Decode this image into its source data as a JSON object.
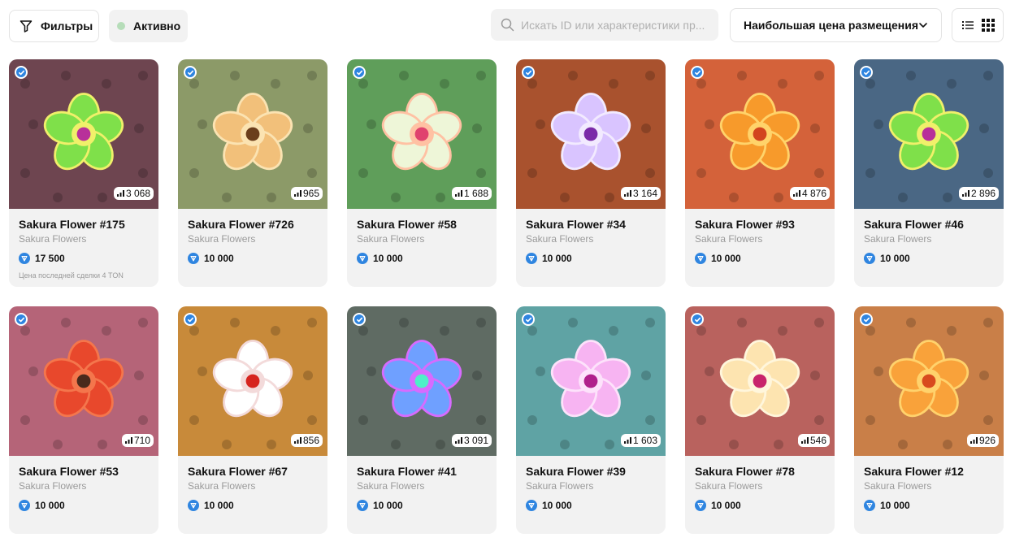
{
  "toolbar": {
    "filters_label": "Фильтры",
    "active_label": "Активно",
    "search_placeholder": "Искать ID или характеристики пр...",
    "sort_label": "Наибольшая цена размещения",
    "icons": [
      "filter-icon",
      "search-icon",
      "chevron-down-icon",
      "list-view-icon",
      "grid-view-icon"
    ]
  },
  "colors": {
    "accent": "#2f85e0",
    "active_dot": "#b6ddb9",
    "card_bg": "#f2f2f2"
  },
  "items": [
    {
      "title": "Sakura Flower #175",
      "collection": "Sakura Flowers",
      "count": "3 068",
      "price": "17 500",
      "last_deal": "Цена последней сделки 4 TON",
      "bg": "#6e4550",
      "petal": "#7fe04a",
      "petal2": "#f0f06a",
      "center": "#b8309a"
    },
    {
      "title": "Sakura Flower #726",
      "collection": "Sakura Flowers",
      "count": "965",
      "price": "10 000",
      "last_deal": "",
      "bg": "#8c9a68",
      "petal": "#f2c07a",
      "petal2": "#fbe3b2",
      "center": "#6b3e1c"
    },
    {
      "title": "Sakura Flower #58",
      "collection": "Sakura Flowers",
      "count": "1 688",
      "price": "10 000",
      "last_deal": "",
      "bg": "#5f9e5a",
      "petal": "#eef6d8",
      "petal2": "#ffc1a3",
      "center": "#e0426e"
    },
    {
      "title": "Sakura Flower #34",
      "collection": "Sakura Flowers",
      "count": "3 164",
      "price": "10 000",
      "last_deal": "",
      "bg": "#a9522e",
      "petal": "#d9c4ff",
      "petal2": "#f2eaff",
      "center": "#7a2aa8"
    },
    {
      "title": "Sakura Flower #93",
      "collection": "Sakura Flowers",
      "count": "4 876",
      "price": "10 000",
      "last_deal": "",
      "bg": "#d4623a",
      "petal": "#f79a2b",
      "petal2": "#ffd36a",
      "center": "#d2441e"
    },
    {
      "title": "Sakura Flower #46",
      "collection": "Sakura Flowers",
      "count": "2 896",
      "price": "10 000",
      "last_deal": "",
      "bg": "#4a6784",
      "petal": "#7fe04a",
      "petal2": "#f0f06a",
      "center": "#b8309a"
    },
    {
      "title": "Sakura Flower #53",
      "collection": "Sakura Flowers",
      "count": "710",
      "price": "10 000",
      "last_deal": "",
      "bg": "#b56478",
      "petal": "#e8482c",
      "petal2": "#f4764c",
      "center": "#4a2a1c"
    },
    {
      "title": "Sakura Flower #67",
      "collection": "Sakura Flowers",
      "count": "856",
      "price": "10 000",
      "last_deal": "",
      "bg": "#c88a3a",
      "petal": "#ffffff",
      "petal2": "#f3dada",
      "center": "#d6241e"
    },
    {
      "title": "Sakura Flower #41",
      "collection": "Sakura Flowers",
      "count": "3 091",
      "price": "10 000",
      "last_deal": "",
      "bg": "#5f6b63",
      "petal": "#6fa0ff",
      "petal2": "#d76bff",
      "center": "#4ef0c8"
    },
    {
      "title": "Sakura Flower #39",
      "collection": "Sakura Flowers",
      "count": "1 603",
      "price": "10 000",
      "last_deal": "",
      "bg": "#5fa3a4",
      "petal": "#f7b4f2",
      "petal2": "#fde2fb",
      "center": "#b0208c"
    },
    {
      "title": "Sakura Flower #78",
      "collection": "Sakura Flowers",
      "count": "546",
      "price": "10 000",
      "last_deal": "",
      "bg": "#b9625e",
      "petal": "#fde4b0",
      "petal2": "#fff6dc",
      "center": "#c8246c"
    },
    {
      "title": "Sakura Flower #12",
      "collection": "Sakura Flowers",
      "count": "926",
      "price": "10 000",
      "last_deal": "",
      "bg": "#c97f48",
      "petal": "#f9a23a",
      "petal2": "#ffd26c",
      "center": "#d84a1e"
    }
  ]
}
